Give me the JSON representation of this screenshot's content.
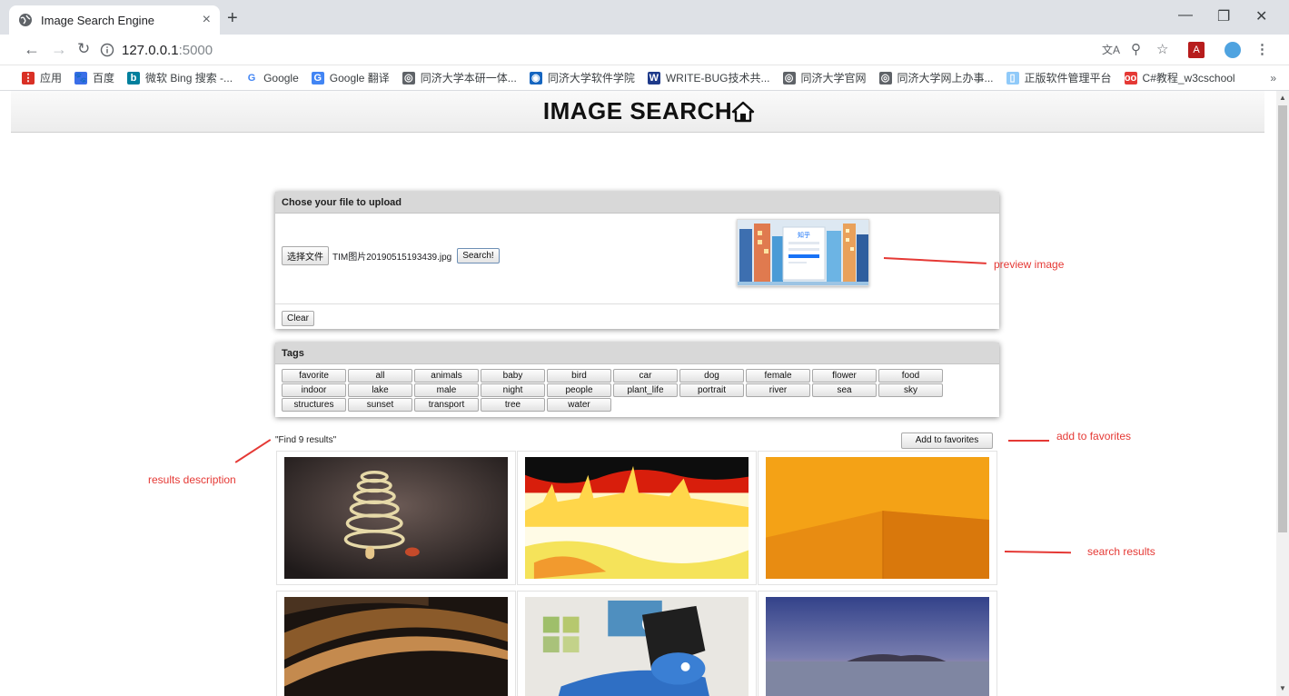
{
  "browser": {
    "tab_title": "Image Search Engine",
    "tab_close": "×",
    "new_tab": "+",
    "url_host": "127.0.0.1",
    "url_port": ":5000",
    "bookmarks": [
      {
        "label": "应用",
        "color": "#d93025",
        "glyph": "⋮"
      },
      {
        "label": "百度",
        "color": "#3a6ee8",
        "glyph": "🐾"
      },
      {
        "label": "微软 Bing 搜索 -...",
        "color": "#00809d",
        "glyph": "b"
      },
      {
        "label": "Google",
        "color": "#ffffff",
        "glyph": "G"
      },
      {
        "label": "Google 翻译",
        "color": "#4285f4",
        "glyph": "G"
      },
      {
        "label": "同济大学本研一体...",
        "color": "#5f6368",
        "glyph": "◎"
      },
      {
        "label": "同济大学软件学院",
        "color": "#1565c0",
        "glyph": "◉"
      },
      {
        "label": "WRITE-BUG技术共...",
        "color": "#1e3a8a",
        "glyph": "W"
      },
      {
        "label": "同济大学官网",
        "color": "#5f6368",
        "glyph": "◎"
      },
      {
        "label": "同济大学网上办事...",
        "color": "#5f6368",
        "glyph": "◎"
      },
      {
        "label": "正版软件管理平台",
        "color": "#90caf9",
        "glyph": "▯"
      },
      {
        "label": "C#教程_w3cschool",
        "color": "#e53935",
        "glyph": "oo"
      }
    ],
    "bookmarks_more": "»"
  },
  "page": {
    "title": "IMAGE SEARCH",
    "upload_panel": {
      "heading": "Chose your file to upload",
      "choose_button": "选择文件",
      "file_name": "TIM图片20190515193439.jpg",
      "search_button": "Search!",
      "clear_button": "Clear"
    },
    "preview": {
      "logo_text": "知乎"
    },
    "tags_panel": {
      "heading": "Tags",
      "tags": [
        "favorite",
        "all",
        "animals",
        "baby",
        "bird",
        "car",
        "dog",
        "female",
        "flower",
        "food",
        "indoor",
        "lake",
        "male",
        "night",
        "people",
        "plant_life",
        "portrait",
        "river",
        "sea",
        "sky",
        "structures",
        "sunset",
        "transport",
        "tree",
        "water"
      ]
    },
    "results_description": "\"Find 9 results\"",
    "add_favorites_button": "Add to favorites",
    "results": [
      {
        "subject": "loops-on-floor"
      },
      {
        "subject": "castle-solarized"
      },
      {
        "subject": "orange-wall"
      },
      {
        "subject": "curved-architecture"
      },
      {
        "subject": "graffiti-wall"
      },
      {
        "subject": "sea-dusk"
      }
    ]
  },
  "annotations": {
    "preview": "preview image",
    "favorites": "add to favorites",
    "results": "search results",
    "description": "results description"
  }
}
